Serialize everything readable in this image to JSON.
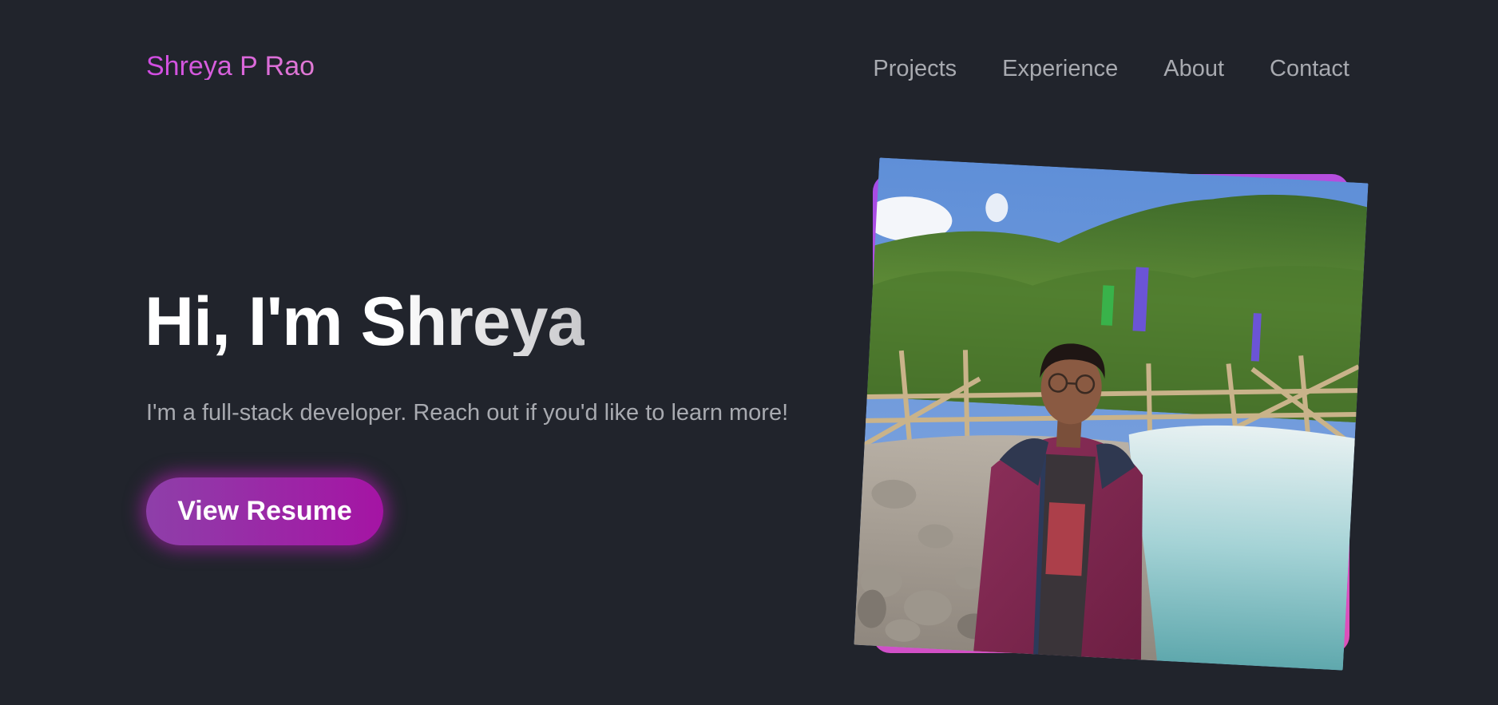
{
  "nav": {
    "logo": "Shreya P Rao",
    "links": [
      "Projects",
      "Experience",
      "About",
      "Contact"
    ]
  },
  "hero": {
    "title": "Hi, I'm Shreya",
    "subtitle": "I'm a full-stack developer. Reach out if you'd like to learn more!",
    "button_label": "View Resume"
  },
  "colors": {
    "background": "#21242c",
    "accent_gradient_start": "#8e3fa9",
    "accent_gradient_end": "#a514a4",
    "logo_color": "#d14be3",
    "muted_text": "#a8aab0"
  },
  "photo": {
    "icon": "profile-photo"
  }
}
